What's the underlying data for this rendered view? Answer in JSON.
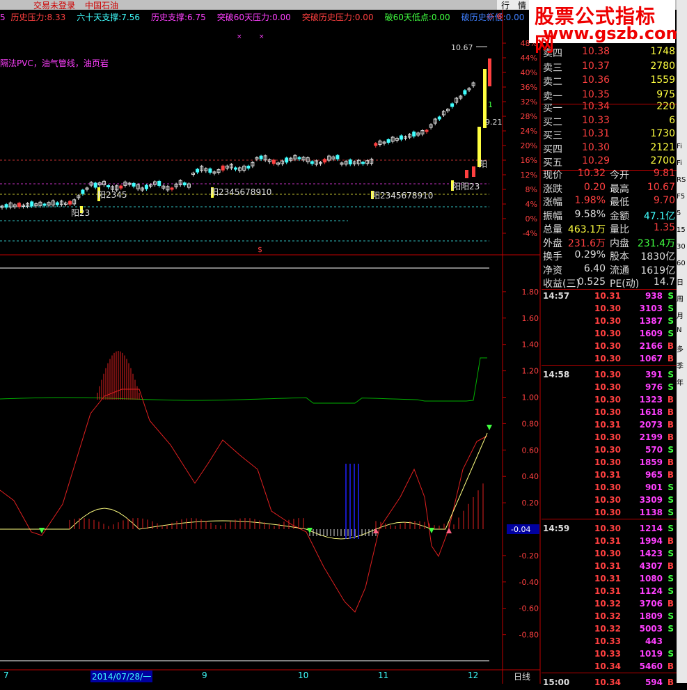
{
  "topbar": {
    "login_status": "交易未登录",
    "stock_name": "中国石油"
  },
  "tabs": {
    "row_tab": "行",
    "info_tab": "情"
  },
  "watermark": {
    "line1": "股票公式指标网",
    "line2": "www.gszb.com"
  },
  "indicator_bar": [
    {
      "label": "历史压力:",
      "value": "8.33",
      "color": "#ff4040",
      "lcolor": "#ff4040"
    },
    {
      "label": "六十天支撑:",
      "value": "7.56",
      "color": "#40ffff",
      "lcolor": "#40ffff"
    },
    {
      "label": "历史支撑:",
      "value": "6.75",
      "color": "#ff40ff",
      "lcolor": "#ff40ff"
    },
    {
      "label": "突破60天压力:",
      "value": "0.00",
      "color": "#ff40ff",
      "lcolor": "#ff40ff"
    },
    {
      "label": "突破历史压力:",
      "value": "0.00",
      "color": "#ff4040",
      "lcolor": "#ff4040"
    },
    {
      "label": "破60天低点:",
      "value": "0.00",
      "color": "#40ff40",
      "lcolor": "#40ff40"
    },
    {
      "label": "破历史新低:",
      "value": "0.00",
      "color": "#4080ff",
      "lcolor": "#4080ff"
    }
  ],
  "left_prefix": "5",
  "concept_text": "隔法PVC，油气管线，油页岩",
  "price_chart": {
    "high_label": "10.67",
    "last_label": "9.21",
    "pct_axis": [
      "48%",
      "44%",
      "40%",
      "36%",
      "32%",
      "28%",
      "24%",
      "20%",
      "16%",
      "12%",
      "8%",
      "4%",
      "0%",
      "-4%"
    ],
    "annotations": [
      "阳23",
      "阳2345",
      "阳2345678910",
      "阳2345678910",
      "阳阳23",
      "阳"
    ],
    "marker": "$",
    "flags": [
      "1"
    ]
  },
  "osc_chart": {
    "axis": [
      "1.80",
      "1.60",
      "1.40",
      "1.20",
      "1.00",
      "0.80",
      "0.60",
      "0.40",
      "0.20",
      "-0.20",
      "-0.40",
      "-0.60",
      "-0.80"
    ],
    "current_value": "-0.04"
  },
  "date_axis": {
    "labels": [
      "7",
      "9",
      "10",
      "11",
      "12"
    ],
    "selected_date": "2014/07/28/一",
    "period": "日线"
  },
  "quote": {
    "asks": [
      {
        "label": "卖四",
        "price": "10.38",
        "vol": "1748"
      },
      {
        "label": "卖三",
        "price": "10.37",
        "vol": "2780"
      },
      {
        "label": "卖二",
        "price": "10.36",
        "vol": "1559"
      },
      {
        "label": "卖一",
        "price": "10.35",
        "vol": "975"
      }
    ],
    "bids": [
      {
        "label": "买一",
        "price": "10.34",
        "vol": "220"
      },
      {
        "label": "买二",
        "price": "10.33",
        "vol": "6"
      },
      {
        "label": "买三",
        "price": "10.31",
        "vol": "1730"
      },
      {
        "label": "买四",
        "price": "10.30",
        "vol": "2121"
      },
      {
        "label": "买五",
        "price": "10.29",
        "vol": "2700"
      }
    ],
    "stats": [
      {
        "l1": "现价",
        "v1": "10.32",
        "c1": "#ff4040",
        "l2": "今开",
        "v2": "9.81",
        "c2": "#ff4040"
      },
      {
        "l1": "涨跌",
        "v1": "0.20",
        "c1": "#ff4040",
        "l2": "最高",
        "v2": "10.67",
        "c2": "#ff4040"
      },
      {
        "l1": "涨幅",
        "v1": "1.98%",
        "c1": "#ff4040",
        "l2": "最低",
        "v2": "9.70",
        "c2": "#ff4040"
      },
      {
        "l1": "振幅",
        "v1": "9.58%",
        "c1": "#dddddd",
        "l2": "金额",
        "v2": "47.1亿",
        "c2": "#40ffff"
      },
      {
        "l1": "总量",
        "v1": "463.1万",
        "c1": "#ffff40",
        "l2": "量比",
        "v2": "1.35",
        "c2": "#ff4040"
      },
      {
        "l1": "外盘",
        "v1": "231.6万",
        "c1": "#ff4040",
        "l2": "内盘",
        "v2": "231.4万",
        "c2": "#40ff40"
      },
      {
        "l1": "换手",
        "v1": "0.29%",
        "c1": "#dddddd",
        "l2": "股本",
        "v2": "1830亿",
        "c2": "#dddddd"
      },
      {
        "l1": "净资",
        "v1": "6.40",
        "c1": "#dddddd",
        "l2": "流通",
        "v2": "1619亿",
        "c2": "#dddddd"
      },
      {
        "l1": "收益(三)",
        "v1": "0.525",
        "c1": "#dddddd",
        "l2": "PE(动)",
        "v2": "14.7",
        "c2": "#dddddd"
      }
    ],
    "ticks": [
      {
        "time": "14:57",
        "price": "10.31",
        "vol": "938",
        "side": "S"
      },
      {
        "time": "",
        "price": "10.30",
        "vol": "3103",
        "side": "S"
      },
      {
        "time": "",
        "price": "10.30",
        "vol": "1387",
        "side": "S"
      },
      {
        "time": "",
        "price": "10.30",
        "vol": "1609",
        "side": "S"
      },
      {
        "time": "",
        "price": "10.30",
        "vol": "2166",
        "side": "B"
      },
      {
        "time": "",
        "price": "10.30",
        "vol": "1067",
        "side": "B"
      },
      {
        "time": "14:58",
        "price": "10.30",
        "vol": "391",
        "side": "S"
      },
      {
        "time": "",
        "price": "10.30",
        "vol": "976",
        "side": "S"
      },
      {
        "time": "",
        "price": "10.30",
        "vol": "1323",
        "side": "B"
      },
      {
        "time": "",
        "price": "10.30",
        "vol": "1618",
        "side": "B"
      },
      {
        "time": "",
        "price": "10.31",
        "vol": "2073",
        "side": "B"
      },
      {
        "time": "",
        "price": "10.30",
        "vol": "2199",
        "side": "B"
      },
      {
        "time": "",
        "price": "10.30",
        "vol": "570",
        "side": "S"
      },
      {
        "time": "",
        "price": "10.30",
        "vol": "1859",
        "side": "B"
      },
      {
        "time": "",
        "price": "10.31",
        "vol": "965",
        "side": "B"
      },
      {
        "time": "",
        "price": "10.30",
        "vol": "901",
        "side": "S"
      },
      {
        "time": "",
        "price": "10.30",
        "vol": "3309",
        "side": "S"
      },
      {
        "time": "",
        "price": "10.30",
        "vol": "1138",
        "side": "S"
      },
      {
        "time": "14:59",
        "price": "10.30",
        "vol": "1214",
        "side": "S"
      },
      {
        "time": "",
        "price": "10.31",
        "vol": "1994",
        "side": "B"
      },
      {
        "time": "",
        "price": "10.30",
        "vol": "1423",
        "side": "S"
      },
      {
        "time": "",
        "price": "10.31",
        "vol": "4307",
        "side": "B"
      },
      {
        "time": "",
        "price": "10.31",
        "vol": "1080",
        "side": "S"
      },
      {
        "time": "",
        "price": "10.31",
        "vol": "1124",
        "side": "S"
      },
      {
        "time": "",
        "price": "10.32",
        "vol": "3706",
        "side": "B"
      },
      {
        "time": "",
        "price": "10.32",
        "vol": "1809",
        "side": "S"
      },
      {
        "time": "",
        "price": "10.32",
        "vol": "5003",
        "side": "S"
      },
      {
        "time": "",
        "price": "10.33",
        "vol": "443",
        "side": ""
      },
      {
        "time": "",
        "price": "10.33",
        "vol": "1019",
        "side": "S"
      },
      {
        "time": "",
        "price": "10.34",
        "vol": "5460",
        "side": "B"
      },
      {
        "time": "15:00",
        "price": "10.34",
        "vol": "594",
        "side": "B"
      }
    ]
  },
  "side_buttons": [
    "Fi",
    "Fi",
    "RS",
    "F5",
    "5",
    "15",
    "30",
    "60",
    "日",
    "周",
    "月",
    "N",
    "多",
    "季",
    "年"
  ],
  "colors": {
    "up": "#ff4040",
    "down": "#40ffff",
    "bg": "#000000",
    "axis": "#c00000",
    "yellow": "#ffff40",
    "magenta": "#ff40ff"
  }
}
